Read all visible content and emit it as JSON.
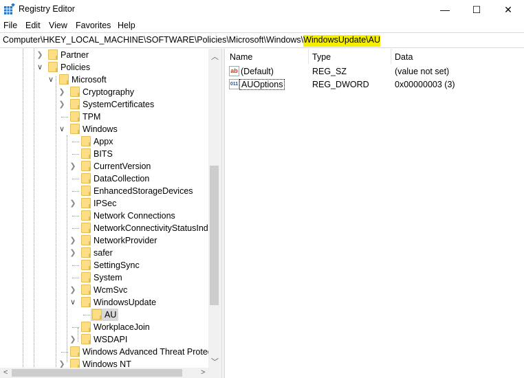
{
  "window": {
    "title": "Registry Editor",
    "minimize": "—",
    "maximize": "☐",
    "close": "✕"
  },
  "menu": [
    "File",
    "Edit",
    "View",
    "Favorites",
    "Help"
  ],
  "address": {
    "prefix": "Computer\\HKEY_LOCAL_MACHINE\\SOFTWARE\\Policies\\Microsoft\\Windows\\",
    "highlighted": "WindowsUpdate\\AU",
    "highlight_color": "#f5f000"
  },
  "tree": [
    {
      "label": "Partner",
      "level": 0,
      "exp": ">"
    },
    {
      "label": "Policies",
      "level": 0,
      "exp": "v"
    },
    {
      "label": "Microsoft",
      "level": 1,
      "exp": "v"
    },
    {
      "label": "Cryptography",
      "level": 2,
      "exp": ">"
    },
    {
      "label": "SystemCertificates",
      "level": 2,
      "exp": ">"
    },
    {
      "label": "TPM",
      "level": 2,
      "exp": ""
    },
    {
      "label": "Windows",
      "level": 2,
      "exp": "v"
    },
    {
      "label": "Appx",
      "level": 3,
      "exp": ""
    },
    {
      "label": "BITS",
      "level": 3,
      "exp": ""
    },
    {
      "label": "CurrentVersion",
      "level": 3,
      "exp": ">"
    },
    {
      "label": "DataCollection",
      "level": 3,
      "exp": ""
    },
    {
      "label": "EnhancedStorageDevices",
      "level": 3,
      "exp": ""
    },
    {
      "label": "IPSec",
      "level": 3,
      "exp": ">"
    },
    {
      "label": "Network Connections",
      "level": 3,
      "exp": ""
    },
    {
      "label": "NetworkConnectivityStatusIndicator",
      "level": 3,
      "exp": ""
    },
    {
      "label": "NetworkProvider",
      "level": 3,
      "exp": ">"
    },
    {
      "label": "safer",
      "level": 3,
      "exp": ">"
    },
    {
      "label": "SettingSync",
      "level": 3,
      "exp": ""
    },
    {
      "label": "System",
      "level": 3,
      "exp": ""
    },
    {
      "label": "WcmSvc",
      "level": 3,
      "exp": ">"
    },
    {
      "label": "WindowsUpdate",
      "level": 3,
      "exp": "v"
    },
    {
      "label": "AU",
      "level": 4,
      "exp": "",
      "selected": true
    },
    {
      "label": "WorkplaceJoin",
      "level": 3,
      "exp": ""
    },
    {
      "label": "WSDAPI",
      "level": 3,
      "exp": ">"
    },
    {
      "label": "Windows Advanced Threat Protection",
      "level": 2,
      "exp": ""
    },
    {
      "label": "Windows NT",
      "level": 2,
      "exp": ">"
    }
  ],
  "values": {
    "headers": {
      "name": "Name",
      "type": "Type",
      "data": "Data"
    },
    "rows": [
      {
        "icon": "ab",
        "name": "(Default)",
        "type": "REG_SZ",
        "data": "(value not set)"
      },
      {
        "icon": "011",
        "name": "AUOptions",
        "type": "REG_DWORD",
        "data": "0x00000003 (3)"
      }
    ]
  }
}
